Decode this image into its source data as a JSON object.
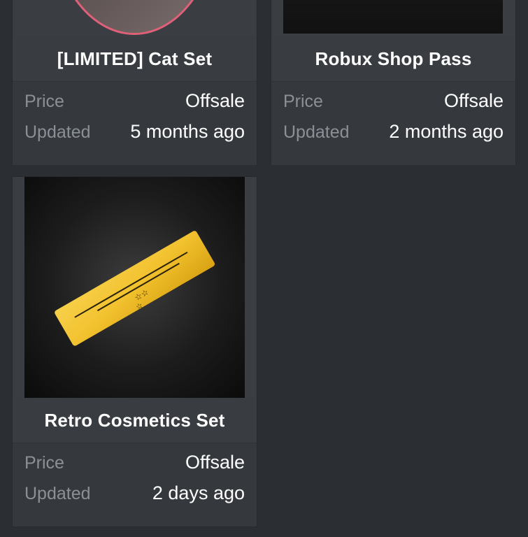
{
  "items": [
    {
      "title": "[LIMITED] Cat Set",
      "price_label": "Price",
      "price_value": "Offsale",
      "updated_label": "Updated",
      "updated_value": "5 months ago"
    },
    {
      "title": "Robux Shop Pass",
      "price_label": "Price",
      "price_value": "Offsale",
      "updated_label": "Updated",
      "updated_value": "2 months ago"
    },
    {
      "title": "Retro Cosmetics Set",
      "price_label": "Price",
      "price_value": "Offsale",
      "updated_label": "Updated",
      "updated_value": "2 days ago"
    }
  ],
  "colors": {
    "background": "#2b2f34",
    "card": "#3a3e43",
    "label": "#8b9096",
    "value": "#ffffff",
    "cat_ring": "#e0607a",
    "ticket_gold": "#f2c12e"
  }
}
